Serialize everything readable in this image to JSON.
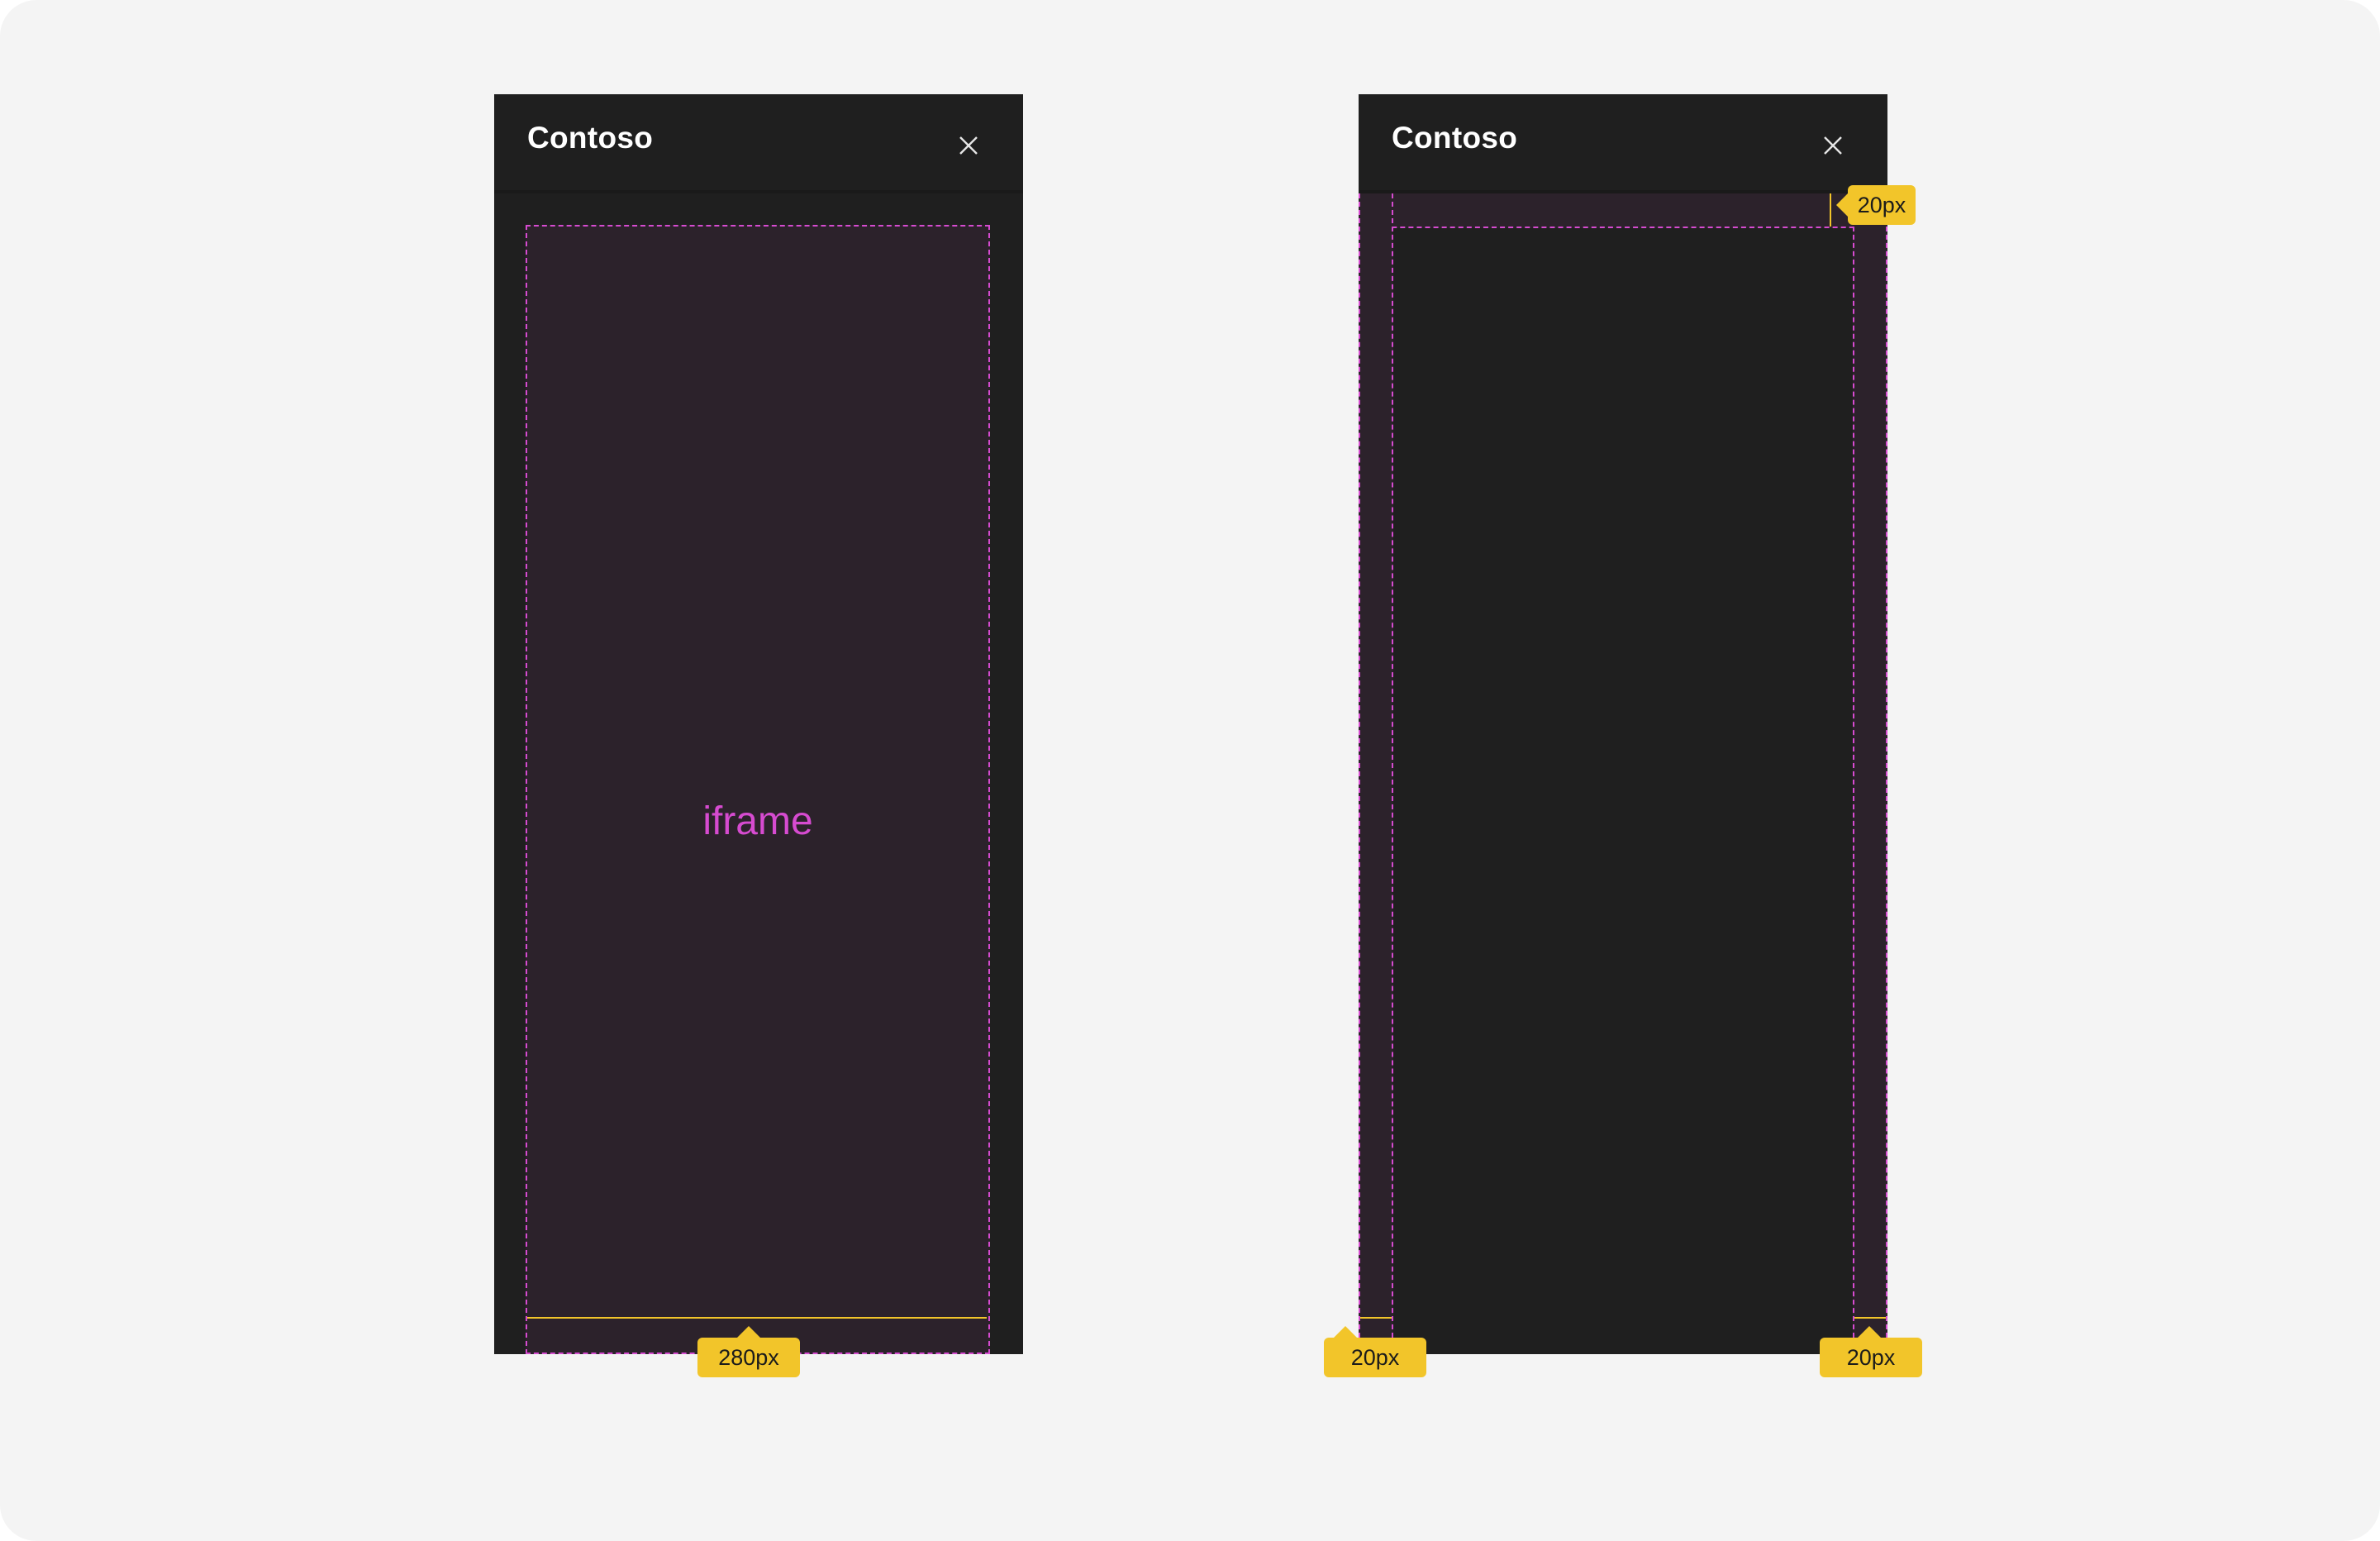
{
  "colors": {
    "background": "#f4f4f4",
    "panel": "#1f1f1f",
    "iframe_fill": "#2c222b",
    "dashed_outline": "#d64bd0",
    "measure": "#f2c52a"
  },
  "left_panel": {
    "title": "Contoso",
    "close_icon": "close-icon",
    "iframe_label": "iframe",
    "width_badge": "280px"
  },
  "right_panel": {
    "title": "Contoso",
    "close_icon": "close-icon",
    "top_padding_badge": "20px",
    "left_padding_badge": "20px",
    "right_padding_badge": "20px"
  }
}
